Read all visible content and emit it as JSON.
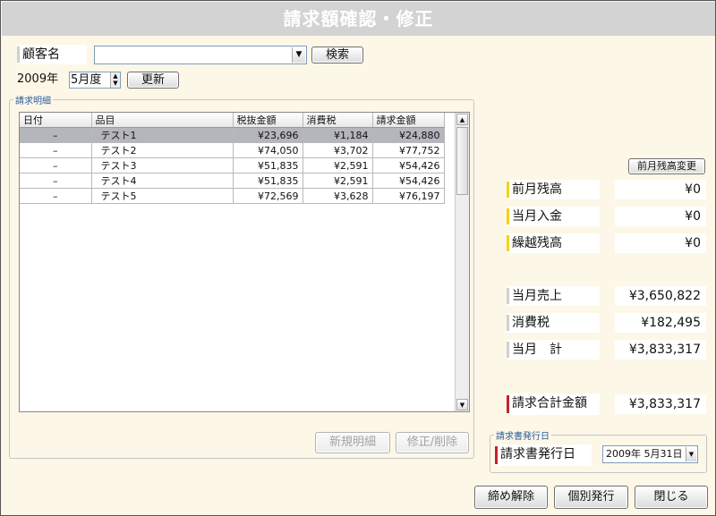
{
  "window": {
    "title": "請求額確認・修正"
  },
  "customer": {
    "label": "顧客名",
    "value": "",
    "search_button": "検索"
  },
  "period": {
    "year_text": "2009年",
    "month_value": "5",
    "month_suffix": "月度",
    "update_button": "更新"
  },
  "details": {
    "group_title": "請求明細",
    "columns": [
      "日付",
      "品目",
      "税抜金額",
      "消費税",
      "請求金額"
    ],
    "rows": [
      {
        "date": "–",
        "item": "テスト1",
        "net": "¥23,696",
        "tax": "¥1,184",
        "total": "¥24,880"
      },
      {
        "date": "–",
        "item": "テスト2",
        "net": "¥74,050",
        "tax": "¥3,702",
        "total": "¥77,752"
      },
      {
        "date": "–",
        "item": "テスト3",
        "net": "¥51,835",
        "tax": "¥2,591",
        "total": "¥54,426"
      },
      {
        "date": "–",
        "item": "テスト4",
        "net": "¥51,835",
        "tax": "¥2,591",
        "total": "¥54,426"
      },
      {
        "date": "–",
        "item": "テスト5",
        "net": "¥72,569",
        "tax": "¥3,628",
        "total": "¥76,197"
      }
    ],
    "new_button": "新規明細",
    "edit_button": "修正/削除"
  },
  "summary": {
    "change_prev_button": "前月残高変更",
    "prev_balance_label": "前月残高",
    "prev_balance": "¥0",
    "month_payment_label": "当月入金",
    "month_payment": "¥0",
    "carry_label": "繰越残高",
    "carry": "¥0",
    "sales_label": "当月売上",
    "sales": "¥3,650,822",
    "tax_label": "消費税",
    "tax": "¥182,495",
    "month_total_label": "当月　計",
    "month_total": "¥3,833,317",
    "grand_label": "請求合計金額",
    "grand": "¥3,833,317"
  },
  "issue": {
    "group_title": "請求書発行日",
    "label": "請求書発行日",
    "date": "2009年 5月31日"
  },
  "footer": {
    "close_billing": "締め解除",
    "individual_issue": "個別発行",
    "close": "閉じる"
  },
  "colors": {
    "yellow_bar": "#f2d21b",
    "red_bar": "#c4232b",
    "selected_row": "#b5b5bd"
  }
}
